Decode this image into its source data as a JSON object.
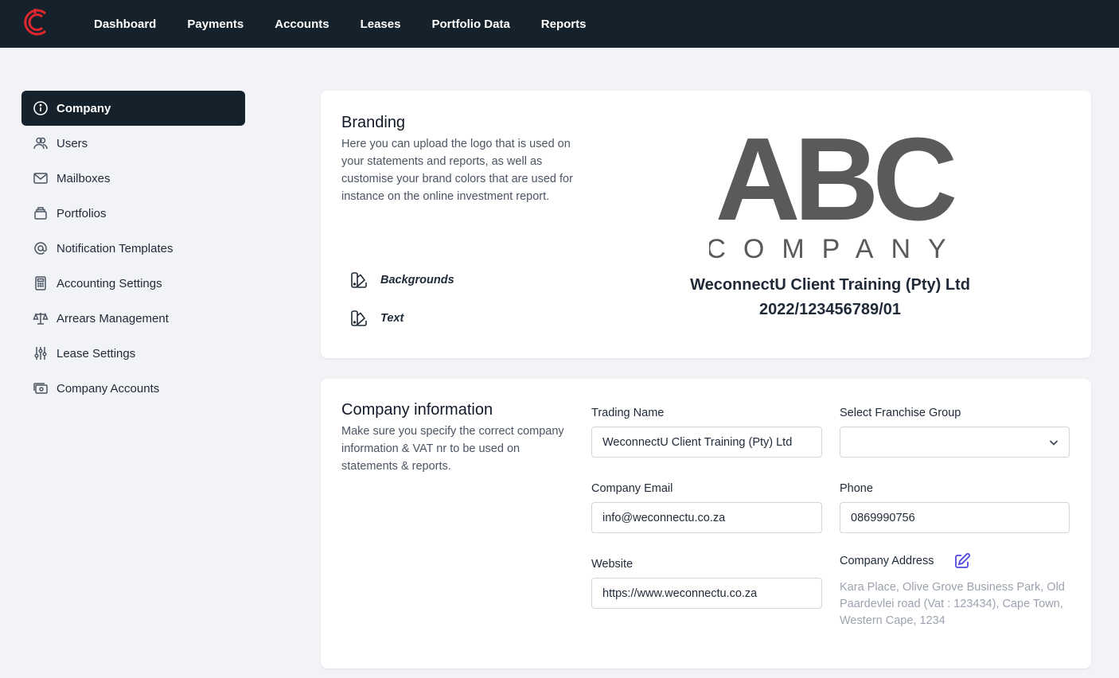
{
  "nav": {
    "items": [
      "Dashboard",
      "Payments",
      "Accounts",
      "Leases",
      "Portfolio Data",
      "Reports"
    ]
  },
  "sidebar": {
    "items": [
      {
        "label": "Company",
        "icon": "info-icon",
        "active": true
      },
      {
        "label": "Users",
        "icon": "users-icon"
      },
      {
        "label": "Mailboxes",
        "icon": "mail-icon"
      },
      {
        "label": "Portfolios",
        "icon": "portfolio-icon"
      },
      {
        "label": "Notification Templates",
        "icon": "at-icon"
      },
      {
        "label": "Accounting Settings",
        "icon": "calculator-icon"
      },
      {
        "label": "Arrears Management",
        "icon": "scale-icon"
      },
      {
        "label": "Lease Settings",
        "icon": "sliders-icon"
      },
      {
        "label": "Company Accounts",
        "icon": "cash-icon"
      }
    ]
  },
  "branding": {
    "title": "Branding",
    "description": "Here you can upload the logo that is used on your statements and reports, as well as customise your brand colors that are used for instance on the online investment report.",
    "options": [
      "Backgrounds",
      "Text"
    ],
    "logo_line1": "ABC",
    "logo_line2": "COMPANY",
    "company_name": "WeconnectU Client Training (Pty) Ltd",
    "registration": "2022/123456789/01",
    "logo_color": "#5a5a5a"
  },
  "company_info": {
    "title": "Company information",
    "description": "Make sure you specify the correct company information & VAT nr to be used on statements & reports.",
    "trading_name_label": "Trading Name",
    "trading_name_value": "WeconnectU Client Training (Pty) Ltd",
    "franchise_label": "Select Franchise Group",
    "franchise_value": "",
    "email_label": "Company Email",
    "email_value": "info@weconnectu.co.za",
    "phone_label": "Phone",
    "phone_value": "0869990756",
    "website_label": "Website",
    "website_value": "https://www.weconnectu.co.za",
    "address_label": "Company Address",
    "address_value": "Kara Place, Olive Grove Business Park, Old Paardevlei road (Vat : 123434), Cape Town, Western Cape, 1234"
  },
  "colors": {
    "nav_bg": "#15222b",
    "accent": "#e0262f",
    "edit_icon": "#4f46e5"
  }
}
